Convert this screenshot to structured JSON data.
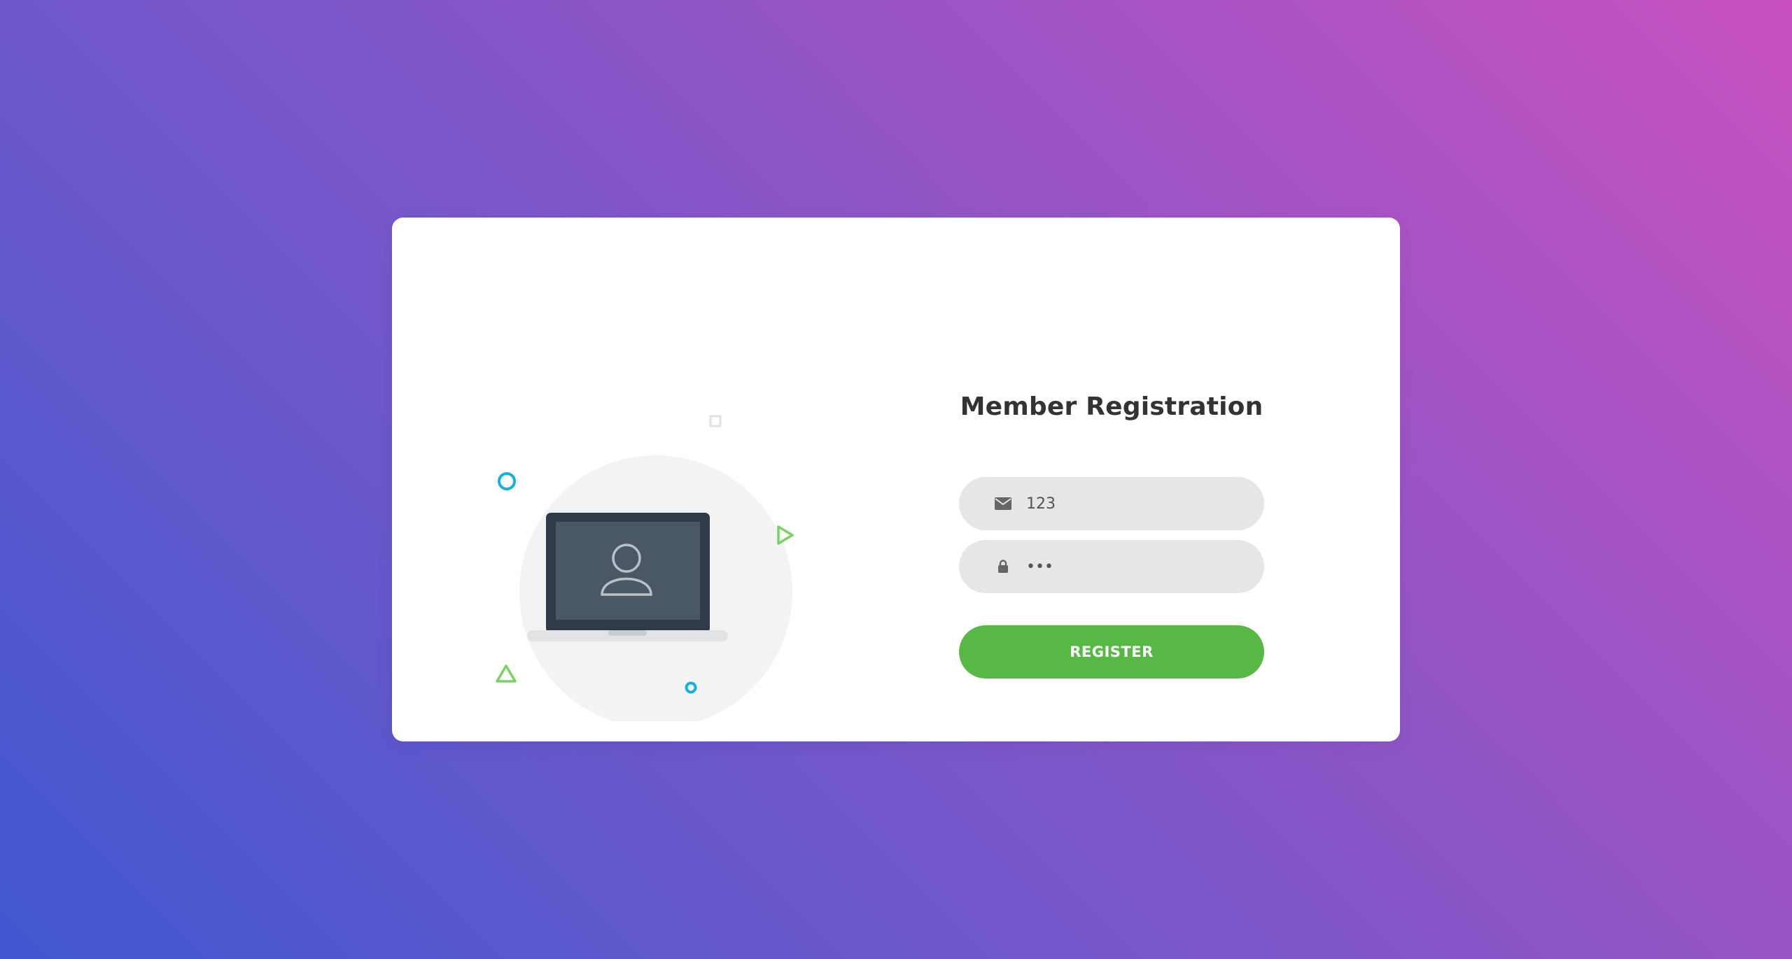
{
  "form": {
    "title": "Member Registration",
    "email": {
      "value": "123",
      "placeholder": "",
      "icon": "envelope-icon"
    },
    "password": {
      "value": "123",
      "placeholder": "",
      "icon": "lock-icon"
    },
    "register_label": "REGISTER"
  },
  "colors": {
    "background_start": "#4158d0",
    "background_end": "#c850c0",
    "accent_green": "#57b846",
    "accent_cyan": "#1ab1d9",
    "field_bg": "#e6e6e6",
    "title_text": "#333333"
  },
  "illustration": {
    "icon": "laptop-user-icon"
  }
}
